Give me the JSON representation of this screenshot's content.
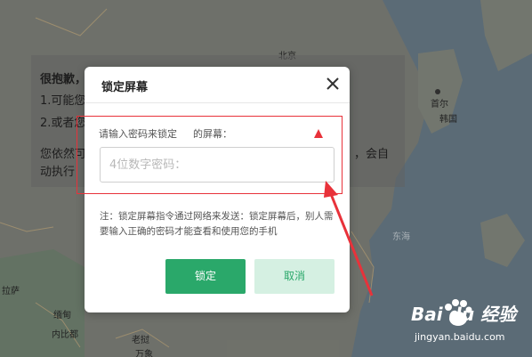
{
  "background": {
    "map_labels": [
      "北京",
      "首尔",
      "韩国",
      "东海",
      "缅甸",
      "内比都",
      "老挝",
      "万象",
      "拉萨"
    ],
    "notice_title": "很抱歉，",
    "notice_line1": "1.可能您",
    "notice_line2": "2.或者您",
    "notice_line3a": "您依然可",
    "notice_line3b": "，会自",
    "notice_line4": "动执行"
  },
  "dialog": {
    "title": "锁定屏幕",
    "close_icon": "close-icon",
    "prompt_prefix": "请输入密码来锁定",
    "prompt_suffix": "的屏幕：",
    "password_placeholder": "4位数字密码：",
    "password_value": "",
    "note": "注：锁定屏幕指令通过网络来发送：锁定屏幕后，别人需要输入正确的密码才能查看和使用您的手机",
    "lock_label": "锁定",
    "cancel_label": "取消"
  },
  "colors": {
    "accent": "#2aa86a",
    "cancel_bg": "#d5f0e2",
    "annotation": "#e8323a"
  },
  "watermark": {
    "logo": "Bai du 经验",
    "url": "jingyan.baidu.com"
  }
}
